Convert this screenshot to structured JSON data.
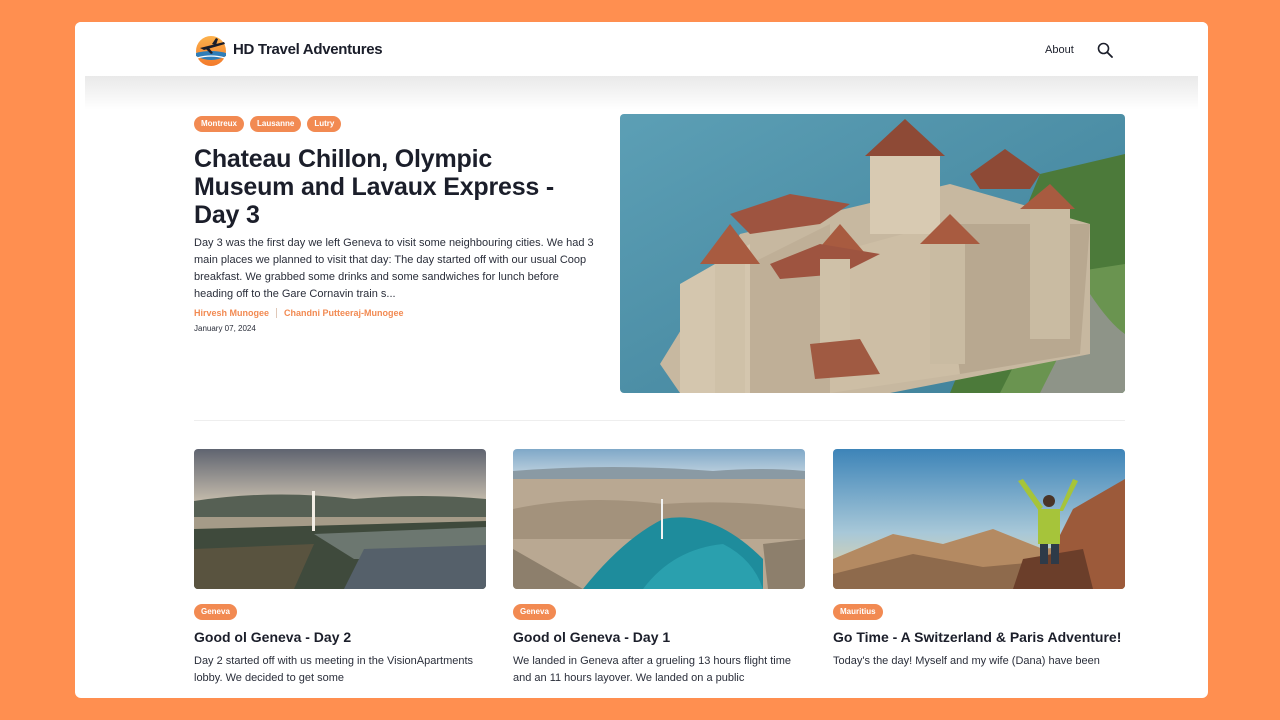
{
  "header": {
    "brand": "HD Travel Adventures",
    "nav_about": "About",
    "search_icon": "search-icon"
  },
  "hero": {
    "tags": [
      "Montreux",
      "Lausanne",
      "Lutry"
    ],
    "title": "Chateau Chillon, Olympic Museum and Lavaux Express - Day 3",
    "excerpt": "Day 3 was the first day we left Geneva to visit some neighbouring cities. We had 3 main places we planned to visit that day: The day started off with our usual Coop breakfast. We grabbed some drinks and some sandwiches for lunch before heading off to the Gare Cornavin train s...",
    "authors": [
      "Hirvesh Munogee",
      "Chandni Putteeraj-Munogee"
    ],
    "date": "January 07, 2024"
  },
  "cards": [
    {
      "tag": "Geneva",
      "title": "Good ol Geneva - Day 2",
      "excerpt": "Day 2 started off with us meeting in the VisionApartments lobby. We decided to get some"
    },
    {
      "tag": "Geneva",
      "title": "Good ol Geneva - Day 1",
      "excerpt": "We landed in Geneva after a grueling 13 hours flight time and an 11 hours layover. We landed on a public"
    },
    {
      "tag": "Mauritius",
      "title": "Go Time - A Switzerland & Paris Adventure!",
      "excerpt": "Today's the day! Myself and my wife (Dana) have been"
    }
  ],
  "colors": {
    "background": "#FF8F50",
    "accent": "#F28A52",
    "text": "#1b1e2a"
  }
}
